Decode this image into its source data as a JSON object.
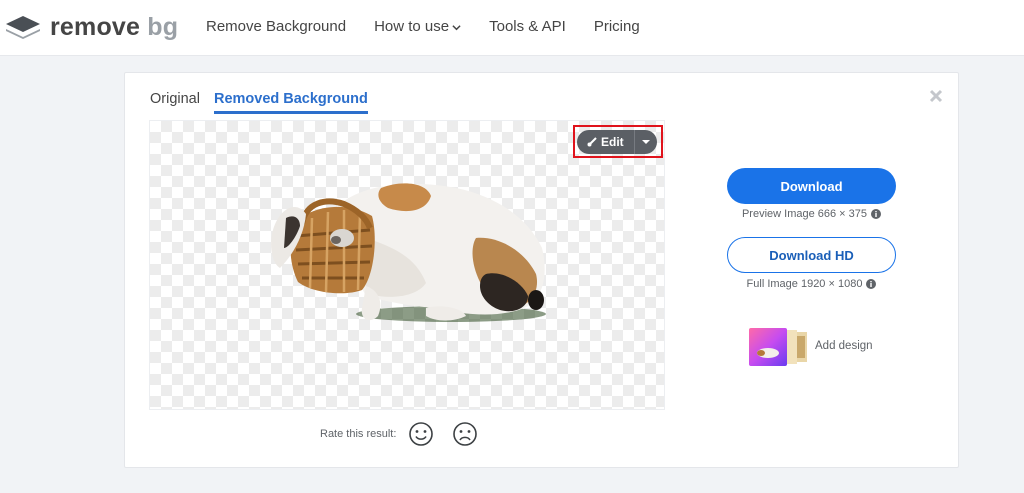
{
  "header": {
    "logo": {
      "word1": "remove",
      "word2": "bg"
    },
    "nav": [
      {
        "label": "Remove Background"
      },
      {
        "label": "How to use",
        "has_dropdown": true
      },
      {
        "label": "Tools & API"
      },
      {
        "label": "Pricing"
      }
    ]
  },
  "editor": {
    "tabs": [
      {
        "label": "Original",
        "active": false
      },
      {
        "label": "Removed Background",
        "active": true
      }
    ],
    "edit_button": {
      "label": "Edit",
      "icon": "brush-icon",
      "dropdown_icon": "caret-down-icon"
    },
    "highlight_color": "#e0131c"
  },
  "download": {
    "primary_label": "Download",
    "preview_caption": "Preview Image 666 × 375",
    "hd_label": "Download HD",
    "full_caption": "Full Image 1920 × 1080"
  },
  "add_design": {
    "label": "Add design"
  },
  "rating": {
    "label": "Rate this result:",
    "icons": [
      "smile-icon",
      "frown-icon"
    ]
  },
  "colors": {
    "accent": "#1a73e8",
    "text": "#454545"
  }
}
